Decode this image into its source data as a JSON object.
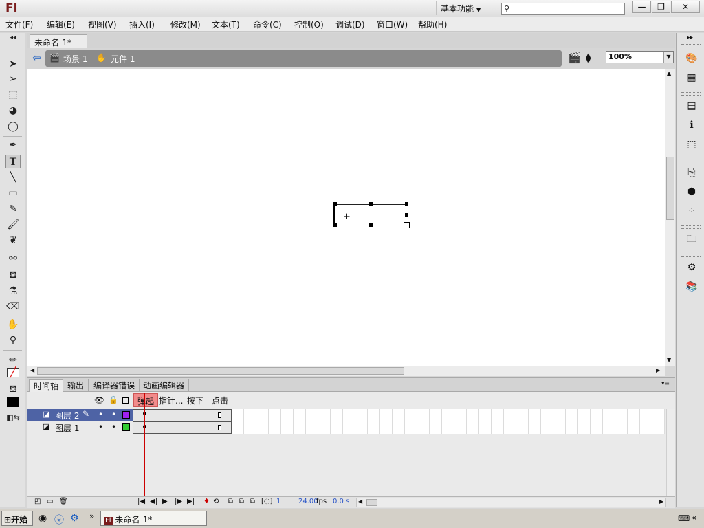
{
  "app": {
    "logo": "Fl",
    "workspace": "基本功能",
    "search_placeholder": ""
  },
  "menu": [
    "文件(F)",
    "编辑(E)",
    "视图(V)",
    "插入(I)",
    "修改(M)",
    "文本(T)",
    "命令(C)",
    "控制(O)",
    "调试(D)",
    "窗口(W)",
    "帮助(H)"
  ],
  "document": {
    "tab_title": "未命名-1*",
    "tab_close": "×"
  },
  "editbar": {
    "scene": "场景 1",
    "symbol": "元件 1",
    "zoom": "100%"
  },
  "panel": {
    "tabs": [
      "时间轴",
      "输出",
      "编译器错误",
      "动画编辑器"
    ],
    "frame_labels": [
      "弹起",
      "指针...",
      "按下",
      "点击"
    ],
    "layers": [
      {
        "name": "图层 2",
        "color": "#a020f0",
        "selected": true
      },
      {
        "name": "图层 1",
        "color": "#33cc33",
        "selected": false
      }
    ],
    "status": {
      "frame": "1",
      "fps": "24.00",
      "fps_unit": "fps",
      "time": "0.0 s"
    }
  },
  "taskbar": {
    "start": "开始",
    "window_title": "未命名-1*"
  },
  "colors": {
    "accent": "#4e63a5",
    "frame_label_bg": "#f28b8b",
    "playhead": "#cc0000"
  }
}
